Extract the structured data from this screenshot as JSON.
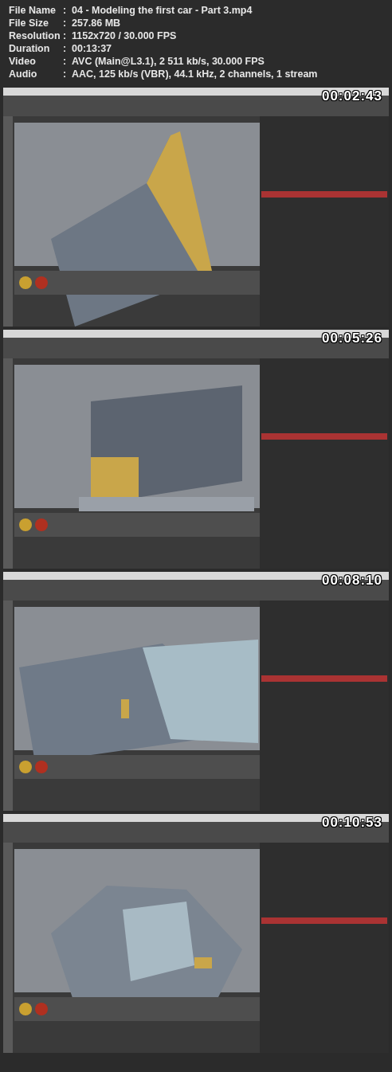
{
  "file_info": [
    {
      "label": "File Name",
      "separator": ":",
      "value": "04 - Modeling the first car - Part 3.mp4"
    },
    {
      "label": "File Size",
      "separator": ":",
      "value": "257.86 MB"
    },
    {
      "label": "Resolution",
      "separator": ":",
      "value": "1152x720 / 30.000 FPS"
    },
    {
      "label": "Duration",
      "separator": ":",
      "value": "00:13:37"
    },
    {
      "label": "Video",
      "separator": ":",
      "value": "AVC (Main@L3.1), 2 511 kb/s, 30.000 FPS"
    },
    {
      "label": "Audio",
      "separator": ":",
      "value": "AAC, 125 kb/s (VBR), 44.1 kHz, 2 channels, 1 stream"
    }
  ],
  "frames": [
    {
      "kind": "picture",
      "timestamp": "00:02:43"
    },
    {
      "kind": "picture",
      "timestamp": "00:05:26"
    },
    {
      "kind": "picture",
      "timestamp": "00:08:10"
    },
    {
      "kind": "picture",
      "timestamp": "00:10:53"
    }
  ]
}
